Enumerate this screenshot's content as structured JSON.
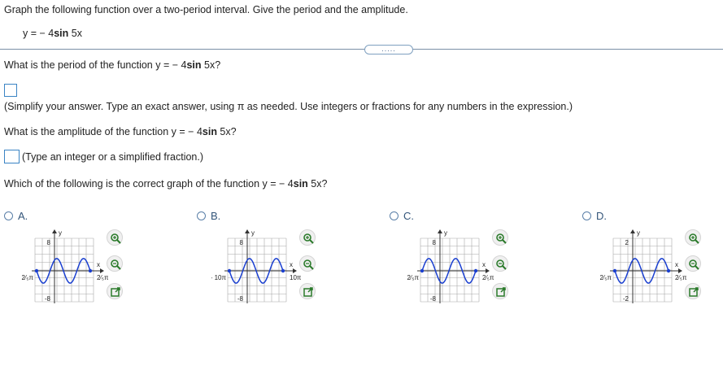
{
  "instruction": "Graph the following function over a two-period interval. Give the period and the amplitude.",
  "function": {
    "prefix": "y = − 4",
    "bold": "sin",
    "suffix": " 5x"
  },
  "more_button": ".....",
  "questions": {
    "period": {
      "prefix": "What is the period of the function y = − 4",
      "bold": "sin",
      "suffix": " 5x?"
    },
    "period_hint": "(Simplify your answer. Type an exact answer, using π as needed. Use integers or fractions for any numbers in the expression.)",
    "amplitude": {
      "prefix": "What is the amplitude of the function y = − 4",
      "bold": "sin",
      "suffix": " 5x?"
    },
    "amplitude_hint": "(Type an integer or a simplified fraction.)",
    "graph": {
      "prefix": "Which of the following is the correct graph of the function y = − 4",
      "bold": "sin",
      "suffix": " 5x?"
    }
  },
  "answers": {
    "period": "",
    "amplitude": ""
  },
  "choices": [
    {
      "label": "A.",
      "y_top": "8",
      "y_bottom": "-8",
      "x_left": "2⁄₅π",
      "x_right": "2⁄₅π",
      "axis_x": "x",
      "axis_y": "y",
      "amplitude": 4,
      "period_pi": 0.4,
      "sign": -1,
      "xmin_pi": -0.4,
      "xmax_pi": 0.4
    },
    {
      "label": "B.",
      "y_top": "8",
      "y_bottom": "-8",
      "x_left": "- 10π",
      "x_right": "10π",
      "axis_x": "x",
      "axis_y": "y",
      "amplitude": 4,
      "period_pi": 10,
      "sign": -1,
      "xmin_pi": -10,
      "xmax_pi": 10
    },
    {
      "label": "C.",
      "y_top": "8",
      "y_bottom": "-8",
      "x_left": "2⁄₅π",
      "x_right": "2⁄₅π",
      "axis_x": "x",
      "axis_y": "y",
      "amplitude": 4,
      "period_pi": 0.4,
      "sign": 1,
      "xmin_pi": -0.4,
      "xmax_pi": 0.4
    },
    {
      "label": "D.",
      "y_top": "2",
      "y_bottom": "-2",
      "x_left": "2⁄₅π",
      "x_right": "2⁄₅π",
      "axis_x": "x",
      "axis_y": "y",
      "amplitude": 1,
      "period_pi": 0.4,
      "sign": -1,
      "xmin_pi": -0.4,
      "xmax_pi": 0.4
    }
  ],
  "icons": {
    "zoom_in": "zoom-in-icon",
    "zoom_out": "zoom-out-icon",
    "popout": "popout-icon"
  },
  "colors": {
    "curve": "#1a3fd0",
    "accent": "#3a84c4",
    "grid": "#999999"
  }
}
